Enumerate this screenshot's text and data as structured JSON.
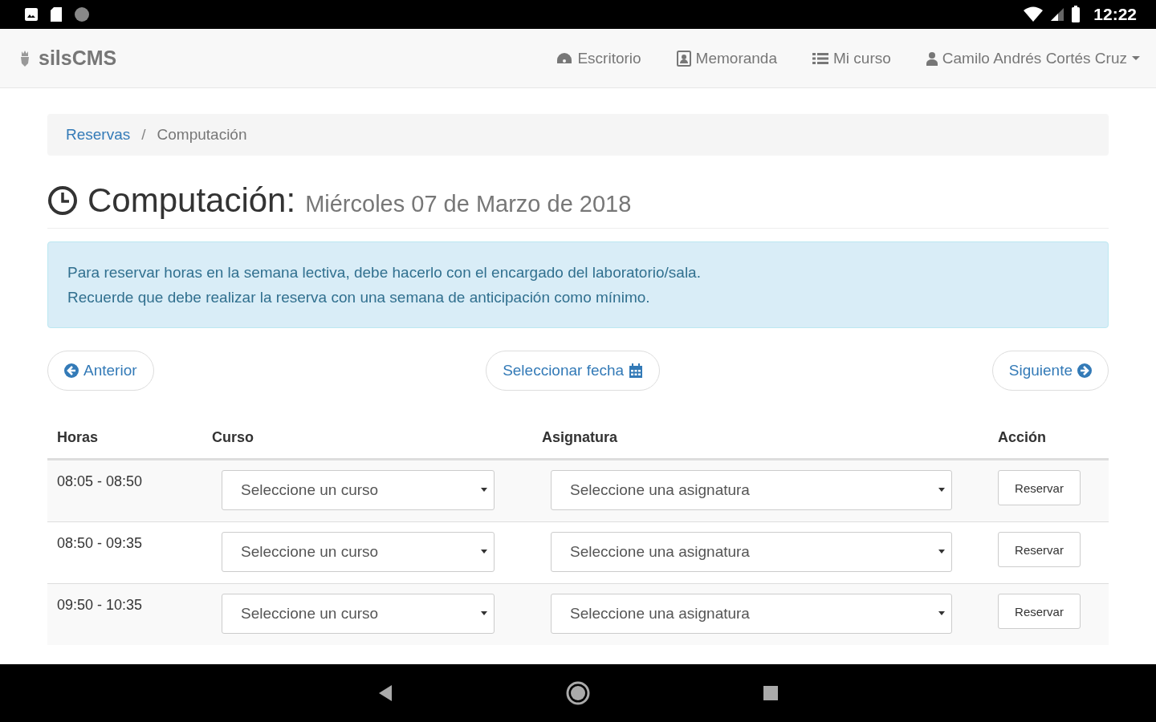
{
  "status_bar": {
    "time": "12:22"
  },
  "navbar": {
    "brand": "silsCMS",
    "items": [
      {
        "label": "Escritorio",
        "kind": "dashboard"
      },
      {
        "label": "Memoranda",
        "kind": "contact"
      },
      {
        "label": "Mi curso",
        "kind": "list"
      }
    ],
    "user": "Camilo Andrés Cortés Cruz"
  },
  "breadcrumb": {
    "items": [
      {
        "label": "Reservas",
        "link": true
      },
      {
        "label": "Computación",
        "link": false
      }
    ],
    "separator": "/"
  },
  "heading": {
    "title": "Computación:",
    "subtitle": "Miércoles 07 de Marzo de 2018"
  },
  "alert": [
    "Para reservar horas en la semana lectiva, debe hacerlo con el encargado del laboratorio/sala.",
    "Recuerde que debe realizar la reserva con una semana de anticipación como mínimo."
  ],
  "pager": {
    "previous": "Anterior",
    "select_date": "Seleccionar fecha",
    "next": "Siguiente"
  },
  "table": {
    "columns": [
      "Horas",
      "Curso",
      "Asignatura",
      "Acción"
    ],
    "rows": [
      {
        "time": "08:05 - 08:50",
        "course": "Seleccione un curso",
        "subject": "Seleccione una asignatura",
        "action": "Reservar"
      },
      {
        "time": "08:50 - 09:35",
        "course": "Seleccione un curso",
        "subject": "Seleccione una asignatura",
        "action": "Reservar"
      },
      {
        "time": "09:50 - 10:35",
        "course": "Seleccione un curso",
        "subject": "Seleccione una asignatura",
        "action": "Reservar"
      }
    ]
  }
}
